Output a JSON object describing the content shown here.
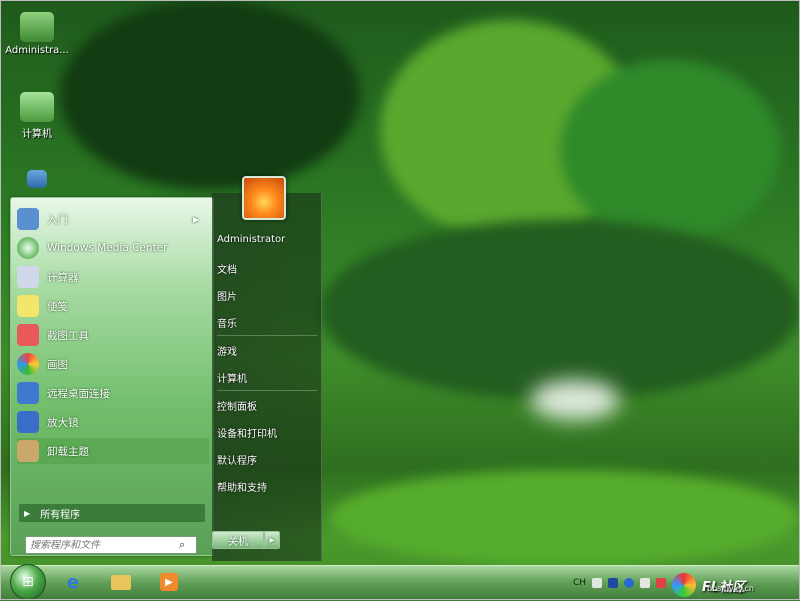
{
  "desktop": {
    "icons": [
      {
        "label": "Administra...",
        "icon": "folder-user-icon"
      },
      {
        "label": "计算机",
        "icon": "computer-icon"
      },
      {
        "label": "",
        "icon": "network-icon"
      }
    ]
  },
  "start_menu": {
    "programs": [
      {
        "label": "入门",
        "icon": "getting-started-icon",
        "has_submenu": true
      },
      {
        "label": "Windows Media Center",
        "icon": "media-center-icon"
      },
      {
        "label": "计算器",
        "icon": "calculator-icon"
      },
      {
        "label": "便笺",
        "icon": "sticky-notes-icon"
      },
      {
        "label": "截图工具",
        "icon": "snipping-tool-icon"
      },
      {
        "label": "画图",
        "icon": "paint-icon"
      },
      {
        "label": "远程桌面连接",
        "icon": "remote-desktop-icon"
      },
      {
        "label": "放大镜",
        "icon": "magnifier-icon"
      },
      {
        "label": "卸载主题",
        "icon": "uninstall-theme-icon",
        "selected": true
      }
    ],
    "all_programs_label": "所有程序",
    "search_placeholder": "搜索程序和文件",
    "user_name": "Administrator",
    "right_links": [
      "文档",
      "图片",
      "音乐",
      "游戏",
      "计算机",
      "控制面板",
      "设备和打印机",
      "默认程序",
      "帮助和支持"
    ],
    "shutdown_label": "关机",
    "shutdown_arrow": "▸"
  },
  "taskbar": {
    "pinned": [
      "internet-explorer-icon",
      "explorer-icon",
      "media-player-icon"
    ],
    "tray": {
      "lang": "CH"
    }
  },
  "watermark": {
    "text": "FL社区",
    "url": "bbs.flyxy.cn"
  },
  "colors": {
    "accent": "#4caa46",
    "menu_top": "#e8f7e8",
    "menu_bottom": "#5aa057",
    "taskbar": "#5f9e55"
  }
}
